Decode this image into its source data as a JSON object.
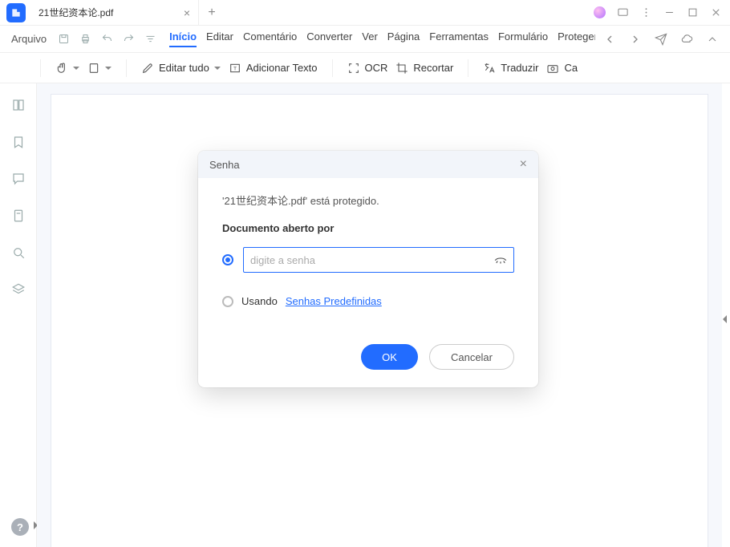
{
  "tab": {
    "title": "21世纪资本论.pdf"
  },
  "menubar": {
    "file": "Arquivo",
    "items": [
      "Início",
      "Editar",
      "Comentário",
      "Converter",
      "Ver",
      "Página",
      "Ferramentas",
      "Formulário",
      "Proteger"
    ],
    "active": "Início"
  },
  "toolbar": {
    "edit_all": "Editar tudo",
    "add_text": "Adicionar Texto",
    "ocr": "OCR",
    "crop": "Recortar",
    "translate": "Traduzir",
    "camera": "Ca"
  },
  "dialog": {
    "title": "Senha",
    "message": "'21世纪资本论.pdf' está protegido.",
    "subtitle": "Documento aberto por",
    "placeholder": "digite a senha",
    "using": "Usando",
    "preset_link": "Senhas Predefinidas",
    "ok": "OK",
    "cancel": "Cancelar"
  },
  "help_symbol": "?"
}
